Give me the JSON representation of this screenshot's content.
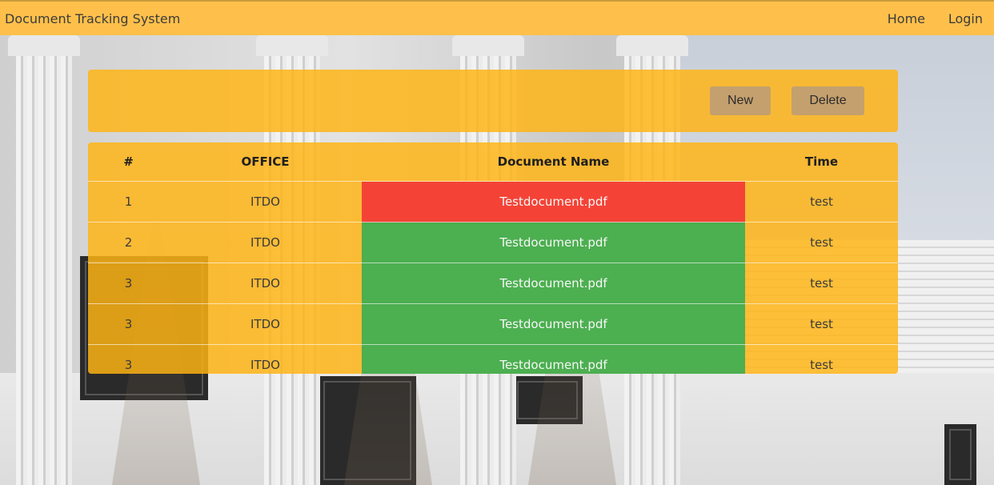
{
  "navbar": {
    "brand": "Document Tracking System",
    "links": {
      "home": "Home",
      "login": "Login"
    }
  },
  "toolbar": {
    "new_label": "New",
    "delete_label": "Delete"
  },
  "table": {
    "headers": {
      "num": "#",
      "office": "OFFICE",
      "document": "Document Name",
      "time": "Time"
    },
    "rows": [
      {
        "num": "1",
        "office": "ITDO",
        "document": "Testdocument.pdf",
        "time": "test",
        "status_color": "#f44336"
      },
      {
        "num": "2",
        "office": "ITDO",
        "document": "Testdocument.pdf",
        "time": "test",
        "status_color": "#4caf50"
      },
      {
        "num": "3",
        "office": "ITDO",
        "document": "Testdocument.pdf",
        "time": "test",
        "status_color": "#4caf50"
      },
      {
        "num": "3",
        "office": "ITDO",
        "document": "Testdocument.pdf",
        "time": "test",
        "status_color": "#4caf50"
      },
      {
        "num": "3",
        "office": "ITDO",
        "document": "Testdocument.pdf",
        "time": "test",
        "status_color": "#4caf50"
      }
    ]
  },
  "colors": {
    "navbar": "#ffc04b",
    "panel": "#ffb414",
    "button": "#c4a06e",
    "status_red": "#f44336",
    "status_green": "#4caf50"
  }
}
